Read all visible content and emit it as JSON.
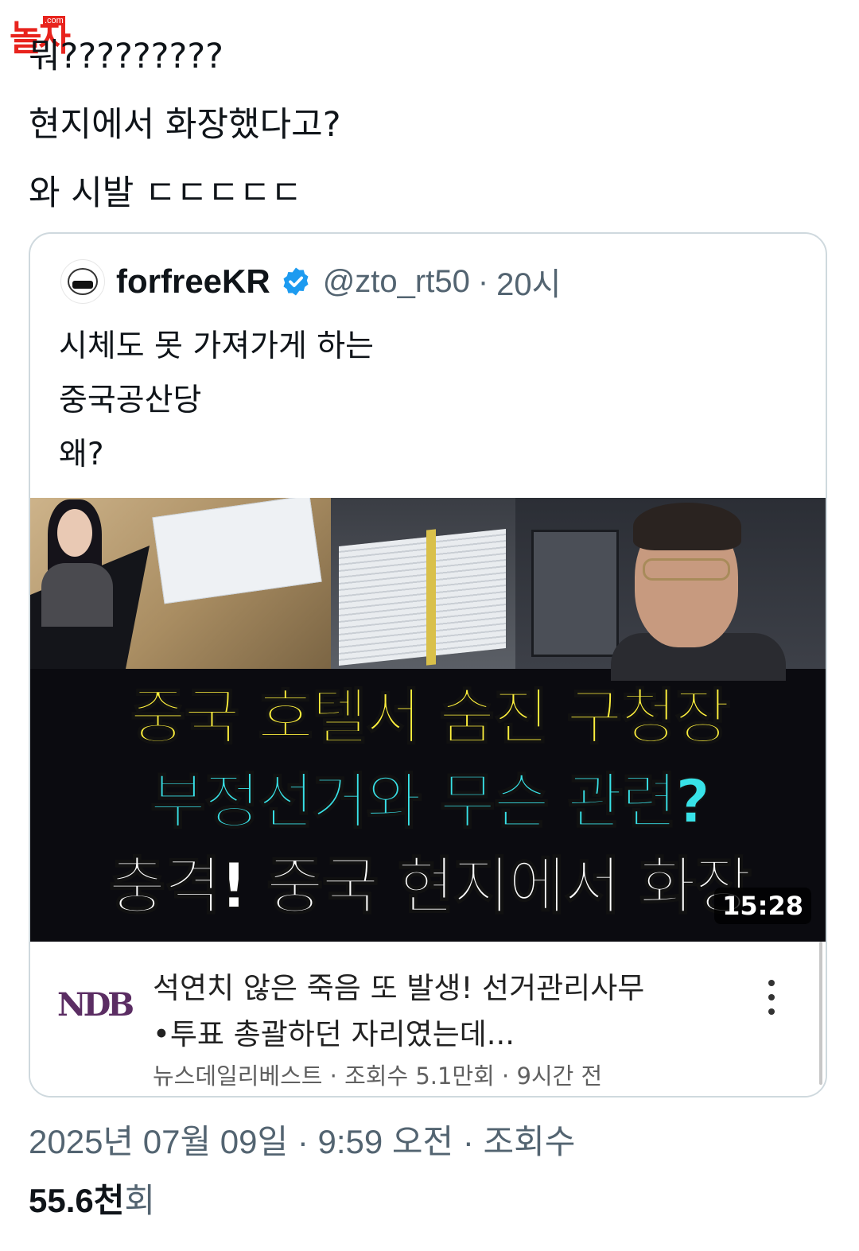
{
  "watermark": {
    "text": "놀자",
    "domain": ".com"
  },
  "tweet": {
    "lines": [
      "뭐?????????",
      "현지에서 화장했다고?",
      "와 시발 ㄷㄷㄷㄷㄷ"
    ],
    "date": "2025년 07월 09일",
    "time": "9:59 오전",
    "views_label": "조회수",
    "views_count": "55.6천",
    "views_unit": "회",
    "separator": "·"
  },
  "quoted_tweet": {
    "name": "forfreeKR",
    "handle": "@zto_rt50",
    "time": "20시",
    "separator": "·",
    "verified_icon": "verified-badge-icon",
    "lines": [
      "시체도 못 가져가게 하는",
      "중국공산당",
      "왜?"
    ],
    "video": {
      "thumbnail_lines": [
        "중국 호텔서 숨진 구청장",
        "부정선거와 무슨 관련?",
        "충격! 중국 현지에서 화장"
      ],
      "duration": "15:28",
      "channel_logo": "NDB",
      "title_lines": [
        "석연치 않은 죽음 또 발생! 선거관리사무",
        "•투표 총괄하던 자리였는데..."
      ],
      "meta": "뉴스데일리베스트 · 조회수 5.1만회 · 9시간 전",
      "menu_icon": "kebab-menu-icon"
    }
  },
  "colors": {
    "text_primary": "#0f1419",
    "text_secondary": "#536471",
    "verified_blue": "#1d9bf0",
    "thumb_yellow": "#fff13d",
    "thumb_cyan": "#38e2e8",
    "border": "#cfd9de"
  }
}
